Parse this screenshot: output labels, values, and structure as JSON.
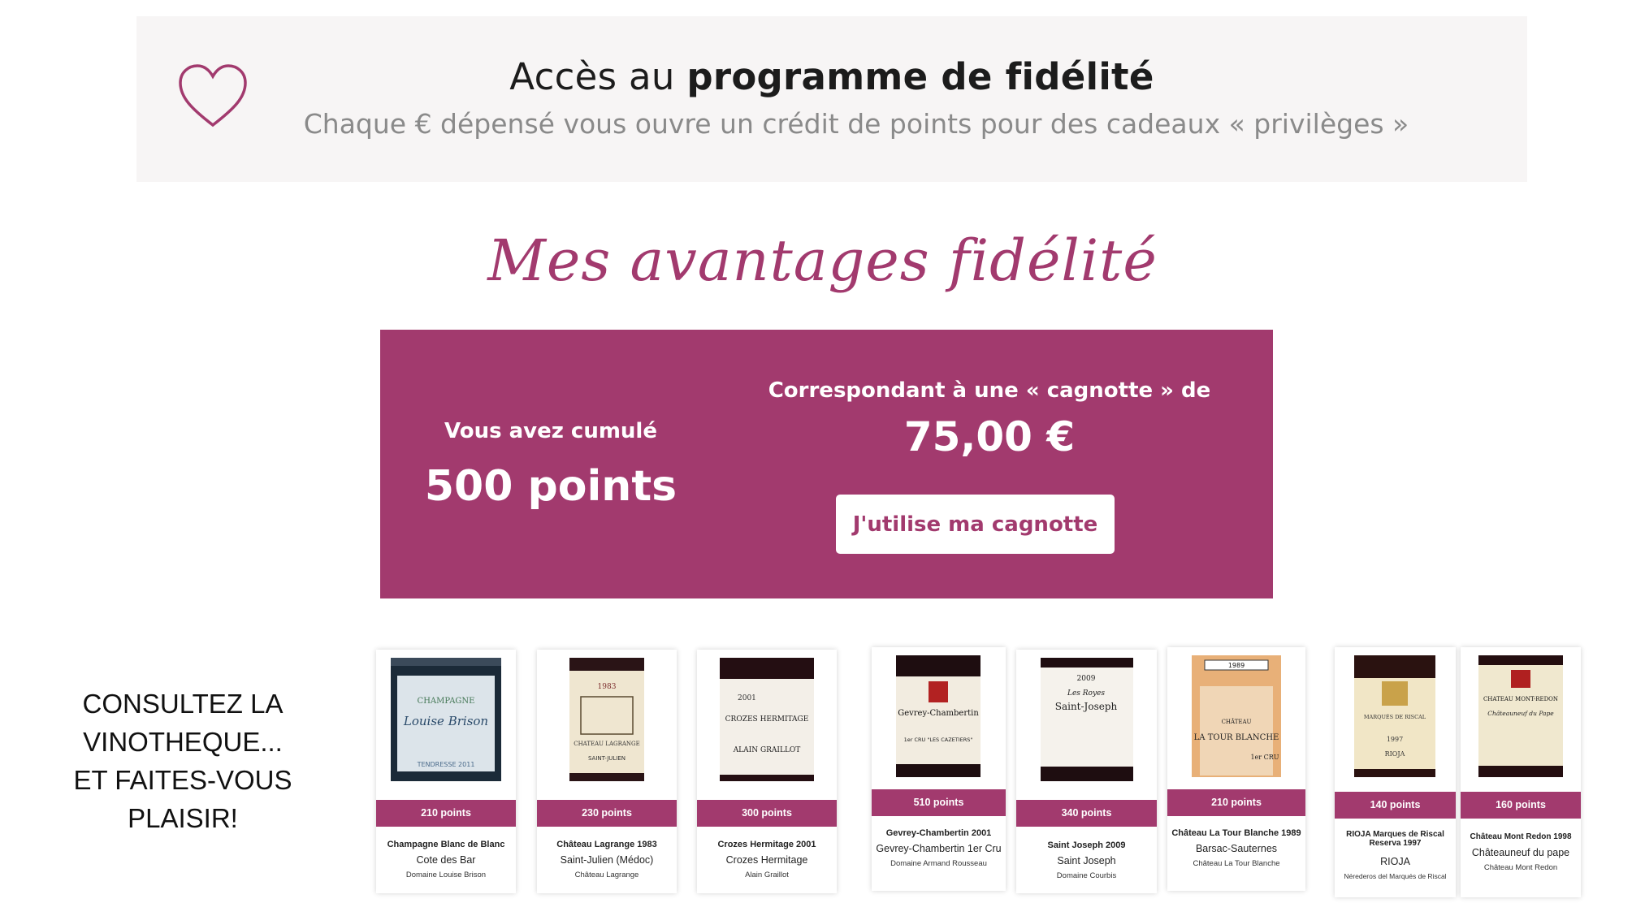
{
  "banner": {
    "title_plain": "Accès au",
    "title_bold": "programme de fidélité",
    "subtitle": "Chaque € dépensé vous ouvre un crédit de points pour des cadeaux « privilèges »",
    "icon": "heart-icon"
  },
  "section_title": "Mes avantages fidélité",
  "loyalty": {
    "cumul_label": "Vous avez cumulé",
    "cumul_value": "500 points",
    "cagnotte_label": "Correspondant à une « cagnotte » de",
    "cagnotte_value": "75,00 €",
    "button_label": "J'utilise ma cagnotte"
  },
  "promo": {
    "lines": [
      "CONSULTEZ LA",
      "VINOTHEQUE...",
      "ET FAITES-VOUS",
      "PLAISIR!"
    ]
  },
  "colors": {
    "accent": "#a23a6e",
    "banner_bg": "#f7f5f5"
  },
  "wines": [
    {
      "points": "210 points",
      "name": "Champagne Blanc de Blanc",
      "appellation": "Cote des Bar",
      "domain": "Domaine Louise Brison",
      "label_text": [
        "CHAMPAGNE",
        "Louise Brison",
        "TENDRESSE 2011"
      ]
    },
    {
      "points": "230 points",
      "name": "Château Lagrange 1983",
      "appellation": "Saint-Julien (Médoc)",
      "domain": "Château Lagrange",
      "label_text": [
        "1983",
        "CHATEAU LAGRANGE",
        "SAINT-JULIEN"
      ]
    },
    {
      "points": "300 points",
      "name": "Crozes Hermitage 2001",
      "appellation": "Crozes Hermitage",
      "domain": "Alain Graillot",
      "label_text": [
        "2001",
        "CROZES HERMITAGE",
        "ALAIN GRAILLOT"
      ]
    },
    {
      "points": "510 points",
      "name": "Gevrey-Chambertin 2001",
      "appellation": "Gevrey-Chambertin 1er Cru",
      "domain": "Domaine Armand Rousseau",
      "label_text": [
        "Gevrey-Chambertin",
        "1er CRU \"LES CAZETIERS\""
      ]
    },
    {
      "points": "340 points",
      "name": "Saint Joseph 2009",
      "appellation": "Saint Joseph",
      "domain": "Domaine Courbis",
      "label_text": [
        "2009",
        "Les Royes",
        "Saint-Joseph"
      ]
    },
    {
      "points": "210 points",
      "name": "Château La Tour Blanche 1989",
      "appellation": "Barsac-Sauternes",
      "domain": "Château La Tour Blanche",
      "label_text": [
        "1989",
        "CHÂTEAU",
        "LA TOUR BLANCHE",
        "1er CRU"
      ]
    },
    {
      "points": "140 points",
      "name": "RIOJA Marques de Riscal Reserva 1997",
      "appellation": "RIOJA",
      "domain": "Nérederos del Marqués de Riscal",
      "label_text": [
        "MARQUÉS DE RISCAL",
        "1997",
        "RIOJA"
      ]
    },
    {
      "points": "160 points",
      "name": "Château Mont Redon 1998",
      "appellation": "Châteauneuf du pape",
      "domain": "Château Mont Redon",
      "label_text": [
        "CHATEAU MONT-REDON",
        "Châteauneuf du Pape"
      ]
    }
  ]
}
